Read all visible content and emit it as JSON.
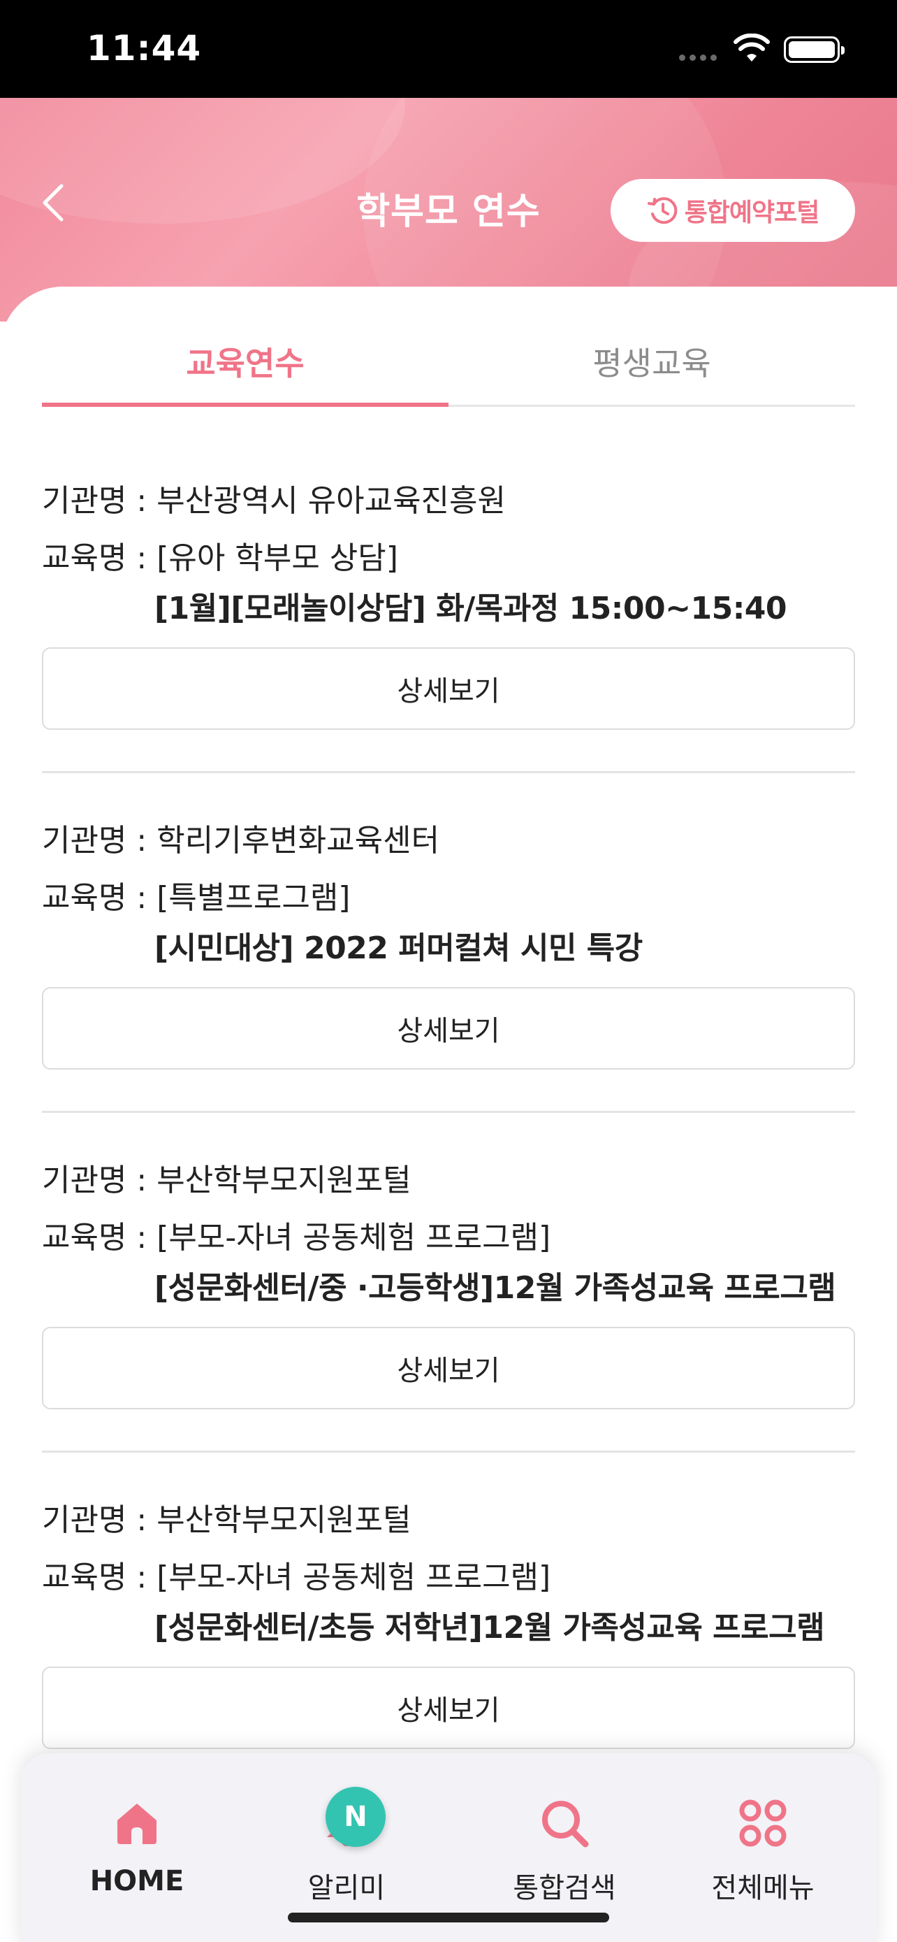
{
  "status_bar": {
    "time": "11:44"
  },
  "header": {
    "title": "학부모 연수",
    "portal_button_label": "통합예약포털",
    "colors": {
      "brand": "#f07488",
      "header_bg": "#f38fa0"
    }
  },
  "tabs": [
    {
      "label": "교육연수",
      "active": true
    },
    {
      "label": "평생교육",
      "active": false
    }
  ],
  "labels": {
    "institution_prefix": "기관명 : ",
    "course_prefix": "교육명 : ",
    "detail_button": "상세보기"
  },
  "courses": [
    {
      "institution": "부산광역시 유아교육진흥원",
      "category": "[유아 학부모 상담]",
      "title": "[1월][모래놀이상담] 화/목과정 15:00~15:40"
    },
    {
      "institution": "학리기후변화교육센터",
      "category": "[특별프로그램]",
      "title": "[시민대상] 2022 퍼머컬쳐 시민 특강"
    },
    {
      "institution": "부산학부모지원포털",
      "category": "[부모-자녀 공동체험 프로그램]",
      "title": "[성문화센터/중 ·고등학생]12월 가족성교육 프로그램"
    },
    {
      "institution": "부산학부모지원포털",
      "category": "[부모-자녀 공동체험 프로그램]",
      "title": "[성문화센터/초등 저학년]12월 가족성교육 프로그램"
    }
  ],
  "bottom_nav": {
    "items": [
      {
        "label": "HOME",
        "icon": "home-icon"
      },
      {
        "label": "알리미",
        "icon": "bell-icon"
      },
      {
        "label": "통합검색",
        "icon": "search-icon"
      },
      {
        "label": "전체메뉴",
        "icon": "grid-menu-icon"
      }
    ],
    "notification_badge": "N",
    "colors": {
      "icon": "#f07488",
      "badge": "#33c3b1"
    }
  }
}
